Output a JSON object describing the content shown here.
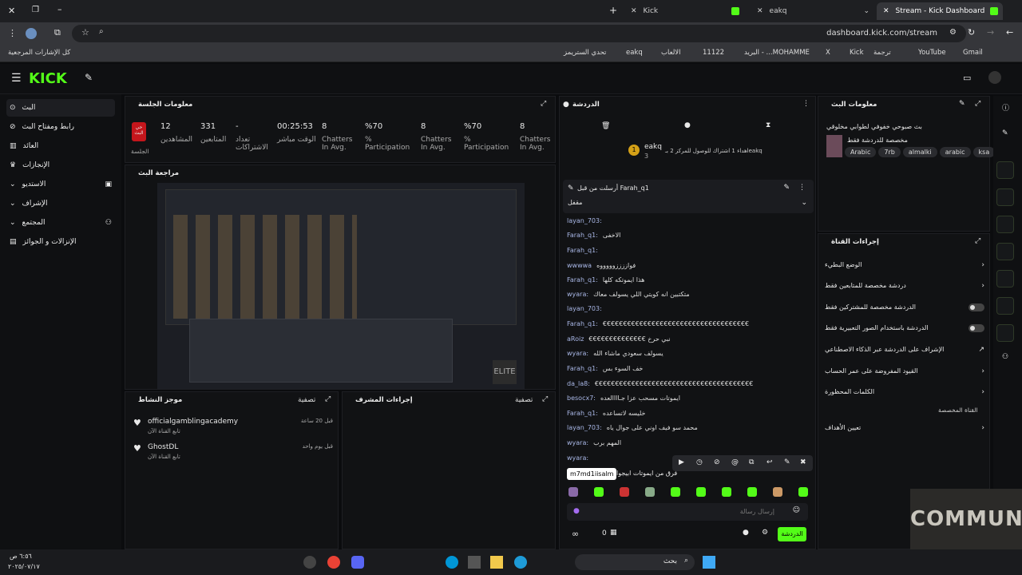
{
  "browser": {
    "tabs": [
      {
        "label": "Kick"
      },
      {
        "label": "eakq"
      },
      {
        "label": "Stream - Kick Dashboard"
      }
    ],
    "url": "dashboard.kick.com/stream",
    "bookmarks": [
      "Gmail",
      "YouTube",
      "ترجمة",
      "Kick",
      "X",
      "البريد - ...MOHAMME",
      "11122",
      "الالعاب",
      "eakq",
      "تحدي الستريمز",
      "كل الإشارات المرجعية"
    ]
  },
  "nav": {
    "logo": "KICK",
    "items": [
      "البث",
      "رابط ومفتاح البث",
      "العائد",
      "الإنجازات",
      "الاستديو",
      "الإشراف",
      "المجتمع",
      "الإنزالات و الجوائز"
    ]
  },
  "session": {
    "title": "معلومات الجلسة",
    "live_badge": "حي البث",
    "live_label": "الجلسة",
    "stats": [
      {
        "value": "12",
        "label": "المشاهدين"
      },
      {
        "value": "331",
        "label": "المتابعين"
      },
      {
        "value": "-",
        "label": "تعداد الاشتراكات"
      },
      {
        "value": "00:25:53",
        "label": "الوقت مباشر"
      },
      {
        "value": "8",
        "label": "Chatters In Avg."
      },
      {
        "value": "%70",
        "label": "% Participation"
      },
      {
        "value": "8",
        "label": "Chatters In Avg."
      },
      {
        "value": "%70",
        "label": "% Participation"
      },
      {
        "value": "8",
        "label": "Chatters In Avg."
      }
    ]
  },
  "preview": {
    "title": "مراجعة البث"
  },
  "activity": {
    "title": "موجز النشاط",
    "filter": "تصفية",
    "items": [
      {
        "name": "officialgamblingacademy",
        "sub": "تابع القناة الآن",
        "time": "قبل 20 ساعة"
      },
      {
        "name": "GhostDL",
        "sub": "تابع القناة الآن",
        "time": "قبل يوم واحد"
      }
    ]
  },
  "modactions": {
    "title": "إجراءات المشرف",
    "filter": "تصفية"
  },
  "chat": {
    "title": "الدردشة",
    "top_user": "eakq",
    "top_rank": "1",
    "top_count": "3",
    "goal_text": "اهداء 1 اشتراك للوصول للمركز 2 بـeakq",
    "pinned_by": "أرسلت من قبل Farah_q1",
    "pinned_text": "مقفل",
    "messages": [
      {
        "user": "layan_703:",
        "text": ""
      },
      {
        "user": "Farah_q1:",
        "text": "الاخفى"
      },
      {
        "user": "Farah_q1:",
        "text": ""
      },
      {
        "user": "wwwwa",
        "text": "فواززززوووووه"
      },
      {
        "user": "Farah_q1:",
        "text": "هذا ايموتكه كلها"
      },
      {
        "user": "wyara:",
        "text": "متكتبين انه كويتي اللي يسولف معاك"
      },
      {
        "user": "layan_703:",
        "text": ""
      },
      {
        "user": "Farah_q1:",
        "text": "€€€€€€€€€€€€€€€€€€€€€€€€€€€€€€€€€€€€"
      },
      {
        "user": "aRoiz",
        "text": "€€€€€€€€€€€€€€ نبي حرخ"
      },
      {
        "user": "wyara:",
        "text": "يسولف سعودي ماشاء الله"
      },
      {
        "user": "Farah_q1:",
        "text": "خف السوء بس"
      },
      {
        "user": "da_la8:",
        "text": "€€€€€€€€€€€€€€€€€€€€€€€€€€€€€€€€€€€€€€€"
      },
      {
        "user": "besocx7:",
        "text": "ايموتات مسحب عزا جـاااالعده"
      },
      {
        "user": "Farah_q1:",
        "text": "خليسه لاتساعده"
      },
      {
        "user": "layan_703:",
        "text": "محمد سو فيف اوني على جوال ياه"
      },
      {
        "user": "wyara:",
        "text": "المهم برب"
      },
      {
        "user": "wyara:",
        "text": ""
      }
    ],
    "tooltip": "m7md1iisalm",
    "tooltip_msg": "فرق من ايموتات ابيجوا",
    "input_placeholder": "إرسال رسالة",
    "send": "الدردشة",
    "viewers": "0"
  },
  "streaminfo": {
    "title": "معلومات البث",
    "stream_title": "بث صبوحي خفوفي لطوابي مخلوقي",
    "category": "مخصصة للدردشة فقط",
    "tags": [
      "Arabic",
      "7rb",
      "almalki",
      "arabic",
      "ksa"
    ]
  },
  "channel": {
    "title": "إجراءات القناة",
    "items": [
      "الوضع البطيء",
      "دردشة مخصصة للمتابعين فقط",
      "الدردشة مخصصة للمشتركين فقط",
      "الدردشة باستخدام الصور التعبيرية فقط",
      "الإشراف على الدردشة عبر الذكاء الاصطناعي",
      "القيود المفروضة على عمر الحساب",
      "الكلمات المحظورة",
      "القناة المخصصة",
      "تعيين الأهداف"
    ]
  },
  "taskbar": {
    "search": "بحث",
    "time": "٦:٥٦ ص",
    "date": "٢٠٢٥/٠٧/١٧"
  },
  "overlay": {
    "community": "COMMUNITY"
  }
}
